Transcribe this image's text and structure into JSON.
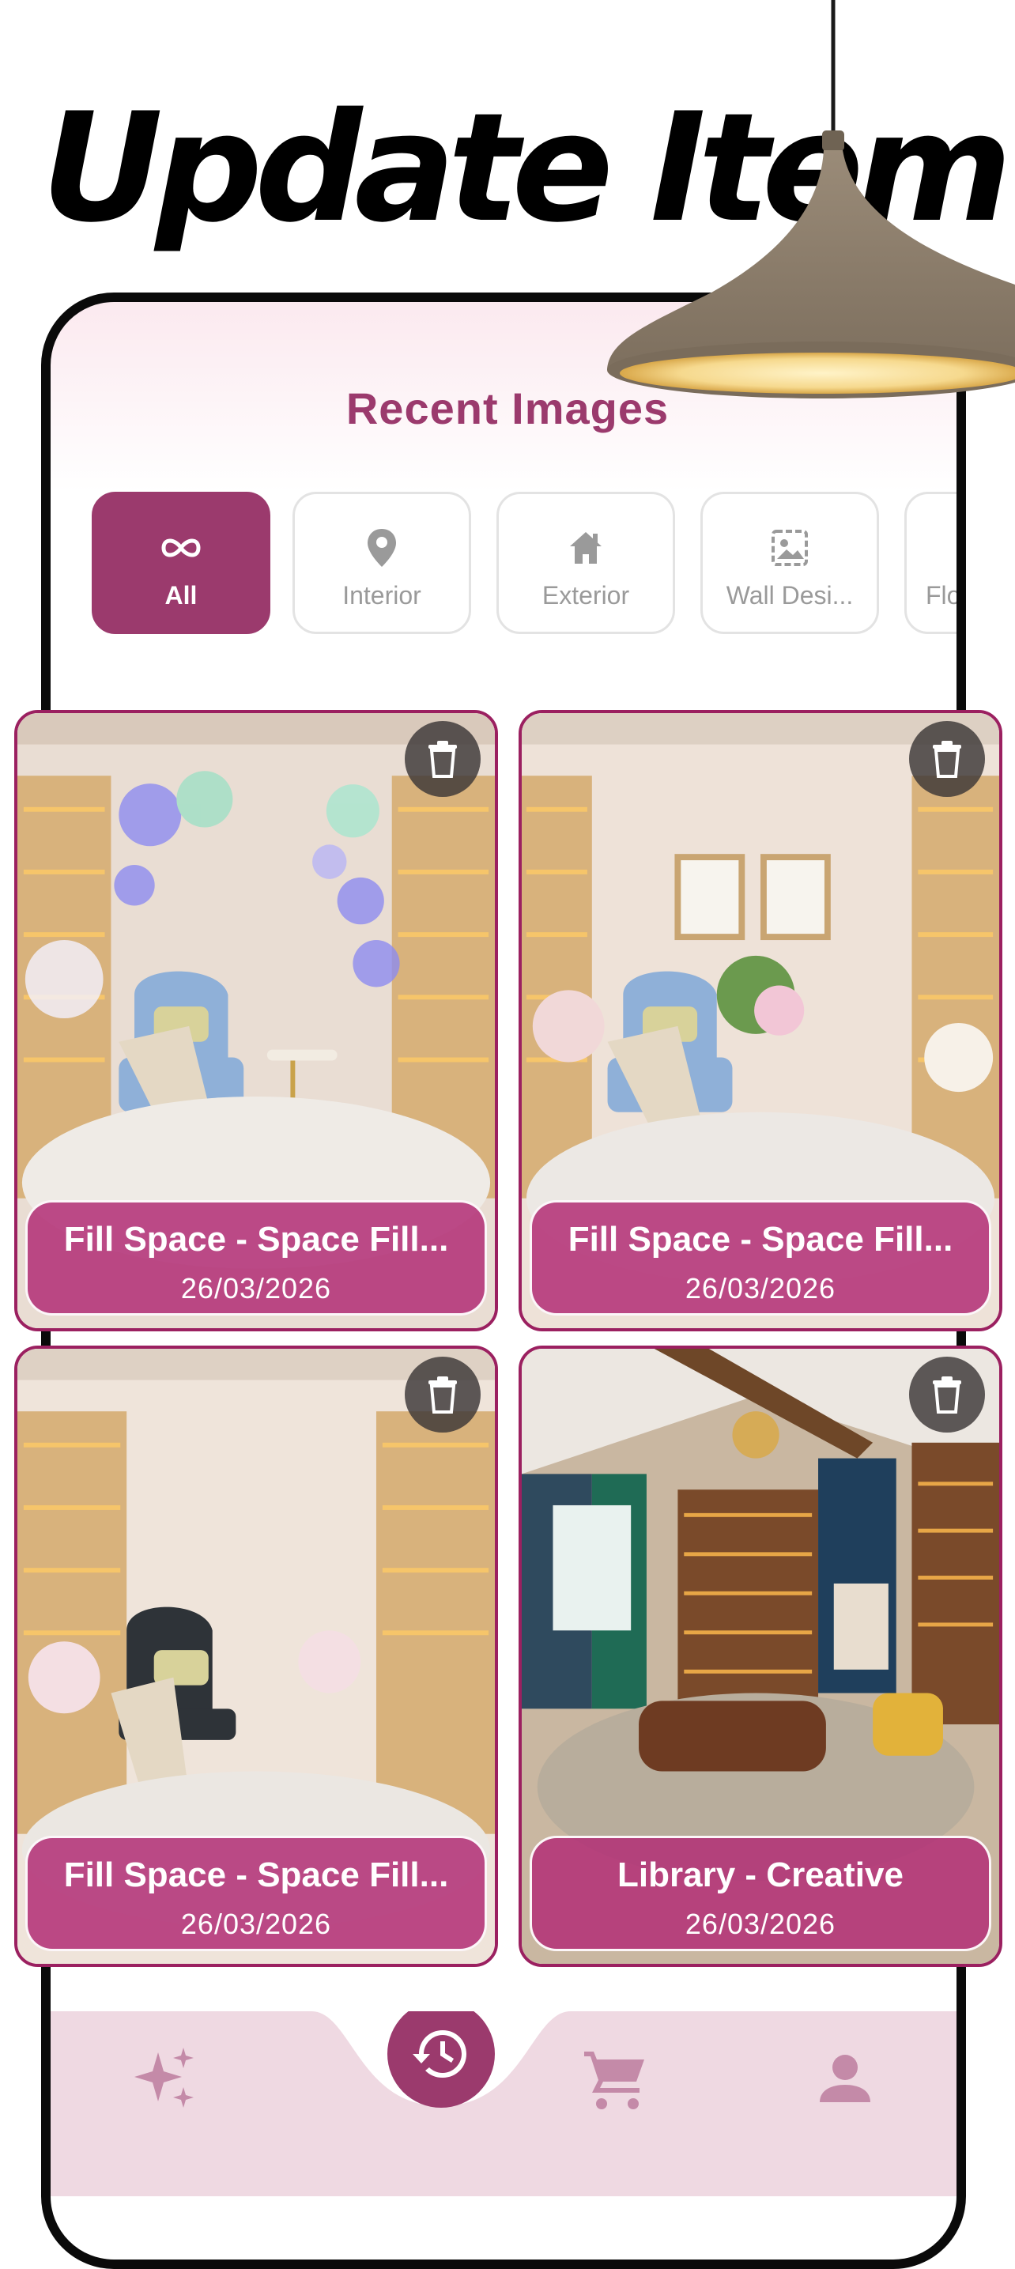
{
  "headline": "Update Item",
  "screen_title": "Recent Images",
  "colors": {
    "accent": "#9b3a6d",
    "card_border": "#9b2060",
    "nav_icon": "#c48aa8"
  },
  "filters": [
    {
      "label": "All",
      "icon": "infinity-icon",
      "active": true
    },
    {
      "label": "Interior",
      "icon": "location-pin-icon",
      "active": false
    },
    {
      "label": "Exterior",
      "icon": "home-icon",
      "active": false
    },
    {
      "label": "Wall Desi...",
      "icon": "wall-image-icon",
      "active": false
    },
    {
      "label": "Flo",
      "icon": "floor-icon",
      "active": false
    }
  ],
  "cards": [
    {
      "title": "Fill Space - Space Fill...",
      "date": "26/03/2026"
    },
    {
      "title": "Fill Space - Space Fill...",
      "date": "26/03/2026"
    },
    {
      "title": "Fill Space - Space Fill...",
      "date": "26/03/2026"
    },
    {
      "title": "Library - Creative",
      "date": "26/03/2026"
    }
  ],
  "nav": [
    {
      "icon": "sparkles-icon"
    },
    {
      "icon": "history-icon",
      "active": true
    },
    {
      "icon": "cart-icon"
    },
    {
      "icon": "profile-icon"
    }
  ]
}
